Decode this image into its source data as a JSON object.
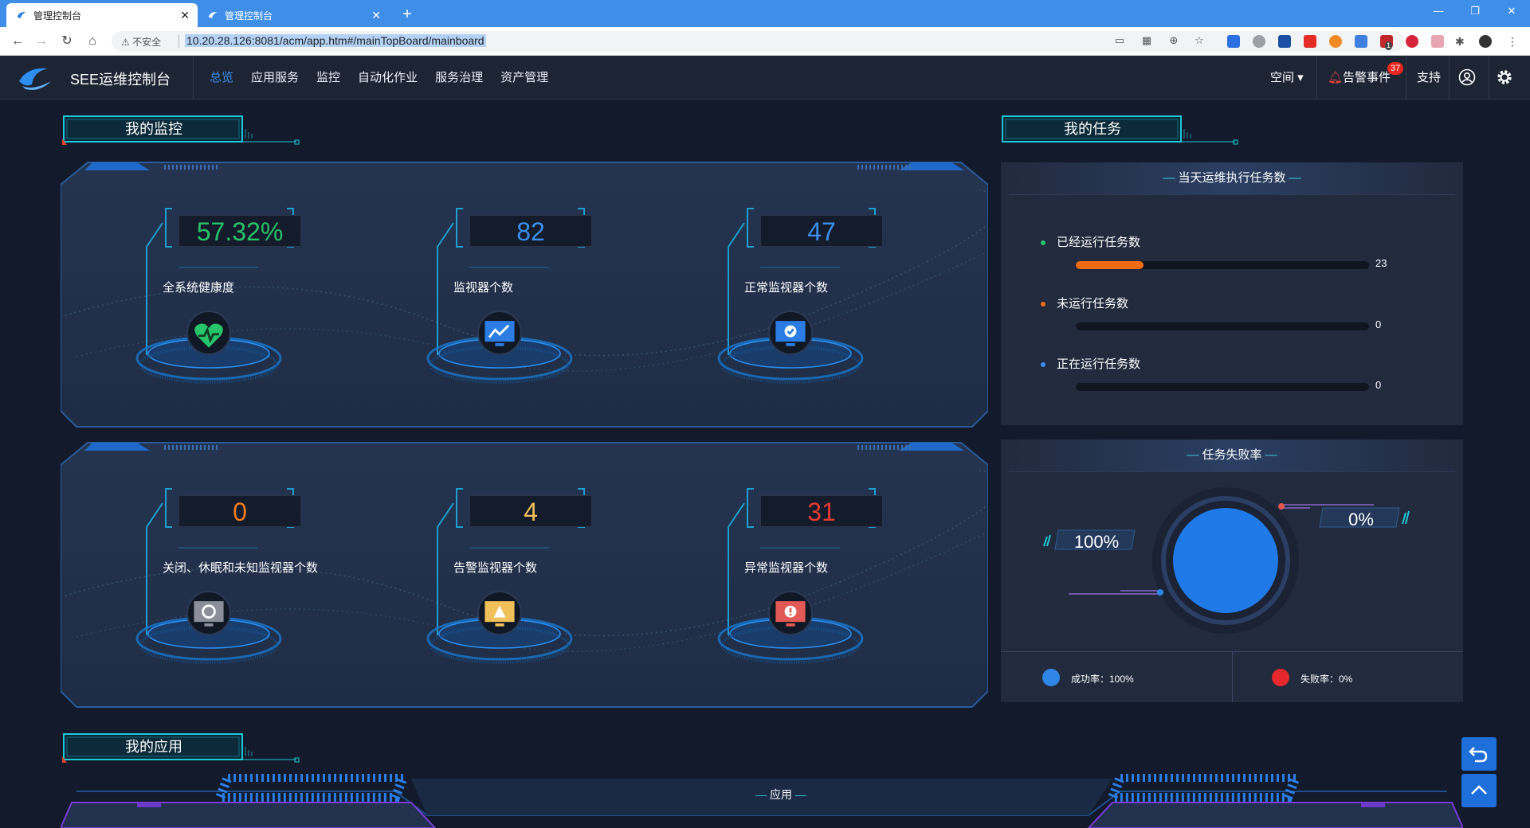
{
  "browser": {
    "tabs": [
      {
        "title": "管理控制台",
        "active": true
      },
      {
        "title": "管理控制台",
        "active": false
      }
    ],
    "new_tab": "+",
    "security_label": "不安全",
    "url": "10.20.28.126:8081/acm/app.htm#/mainTopBoard/mainboard",
    "ext_badge": "1"
  },
  "app": {
    "title": "SEE运维控制台",
    "nav": [
      "总览",
      "应用服务",
      "监控",
      "自动化作业",
      "服务治理",
      "资产管理"
    ],
    "active_nav": "总览",
    "right_nav": {
      "space": "空间",
      "alarm": "告警事件",
      "alarm_count": "37",
      "support": "支持"
    }
  },
  "monitor": {
    "title": "我的监控",
    "stats": [
      {
        "value": "57.32%",
        "label": "全系统健康度",
        "color": "#27c46a",
        "icon": "heart-pulse-icon"
      },
      {
        "value": "82",
        "label": "监视器个数",
        "color": "#3b8ff0",
        "icon": "monitor-chart-icon"
      },
      {
        "value": "47",
        "label": "正常监视器个数",
        "color": "#3b8ff0",
        "icon": "monitor-check-icon"
      },
      {
        "value": "0",
        "label": "关闭、休眠和未知监视器个数",
        "color": "#f07c22",
        "icon": "monitor-off-icon"
      },
      {
        "value": "4",
        "label": "告警监视器个数",
        "color": "#f0c15a",
        "icon": "monitor-warning-icon"
      },
      {
        "value": "31",
        "label": "异常监视器个数",
        "color": "#e63a35",
        "icon": "monitor-error-icon"
      }
    ]
  },
  "tasks": {
    "title": "我的任务",
    "today_header": "当天运维执行任务数",
    "rows": [
      {
        "label": "已经运行任务数",
        "value": "23",
        "fraction": 0.23,
        "dot": "#27c46a"
      },
      {
        "label": "未运行任务数",
        "value": "0",
        "fraction": 0,
        "dot": "#f06b12"
      },
      {
        "label": "正在运行任务数",
        "value": "0",
        "fraction": 0,
        "dot": "#3b8ff0"
      }
    ],
    "fail_header": "任务失败率",
    "success_pct": "100%",
    "fail_pct": "0%",
    "legend": [
      {
        "label": "成功率：100%",
        "color": "#2f86e6"
      },
      {
        "label": "失败率：0%",
        "color": "#e6282c"
      }
    ]
  },
  "apps": {
    "title": "我的应用",
    "header": "应用"
  }
}
